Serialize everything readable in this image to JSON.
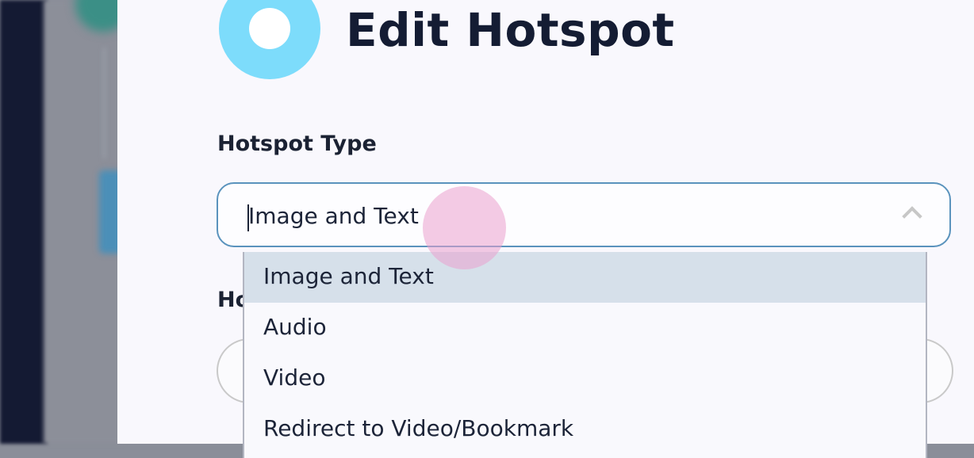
{
  "colors": {
    "logo": "#7ddcfb",
    "title_text": "#141c33",
    "select_border": "#5a93bd",
    "option_highlight": "#d6e0ea",
    "touch_indicator": "#eba0cd"
  },
  "dialog": {
    "title": "Edit Hotspot",
    "logo_icon": "ring-logo-icon"
  },
  "hotspot_type": {
    "label": "Hotspot Type",
    "selected_value": "Image and Text",
    "chevron_icon": "chevron-up-icon",
    "expanded": true,
    "options": [
      {
        "label": "Image and Text",
        "highlighted": true
      },
      {
        "label": "Audio",
        "highlighted": false
      },
      {
        "label": "Video",
        "highlighted": false
      },
      {
        "label": "Redirect to Video/Bookmark",
        "highlighted": false
      }
    ]
  },
  "second_field": {
    "label_visible": "Ho"
  }
}
